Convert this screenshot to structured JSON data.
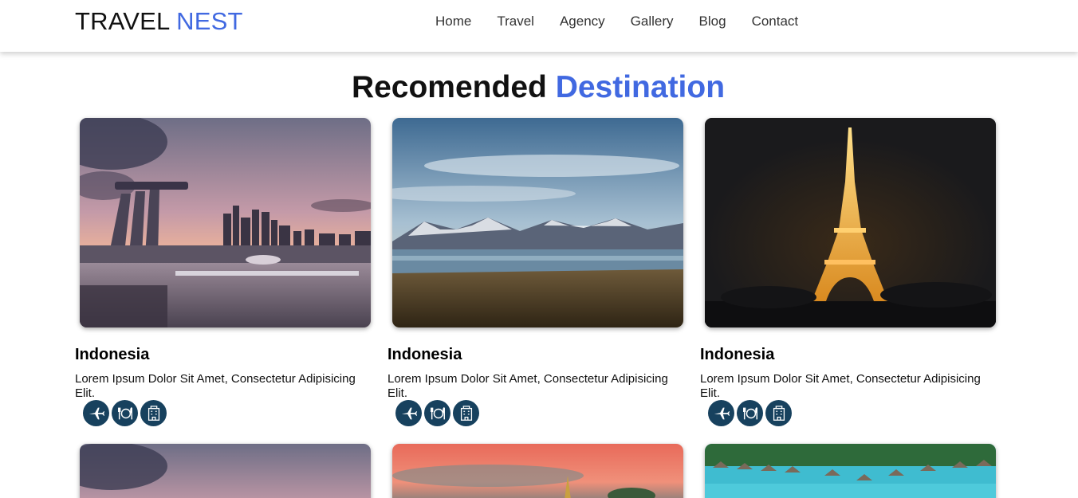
{
  "header": {
    "logo_part1": "TRAVEL",
    "logo_part2": "NEST",
    "nav": [
      "Home",
      "Travel",
      "Agency",
      "Gallery",
      "Blog",
      "Contact"
    ]
  },
  "section": {
    "title_part1": "Recomended",
    "title_part2": "Destination"
  },
  "cards": [
    {
      "title": "Indonesia",
      "description": "Lorem Ipsum Dolor Sit Amet, Consectetur Adipisicing Elit.",
      "image": "city-skyline-sunset-photo"
    },
    {
      "title": "Indonesia",
      "description": "Lorem Ipsum Dolor Sit Amet, Consectetur Adipisicing Elit.",
      "image": "mountain-lake-photo"
    },
    {
      "title": "Indonesia",
      "description": "Lorem Ipsum Dolor Sit Amet, Consectetur Adipisicing Elit.",
      "image": "eiffel-tower-night-photo"
    }
  ],
  "feature_icons": [
    "airplane-icon",
    "dining-icon",
    "hotel-icon"
  ],
  "colors": {
    "accent": "#4169e1",
    "icon_bg": "#17415e"
  }
}
